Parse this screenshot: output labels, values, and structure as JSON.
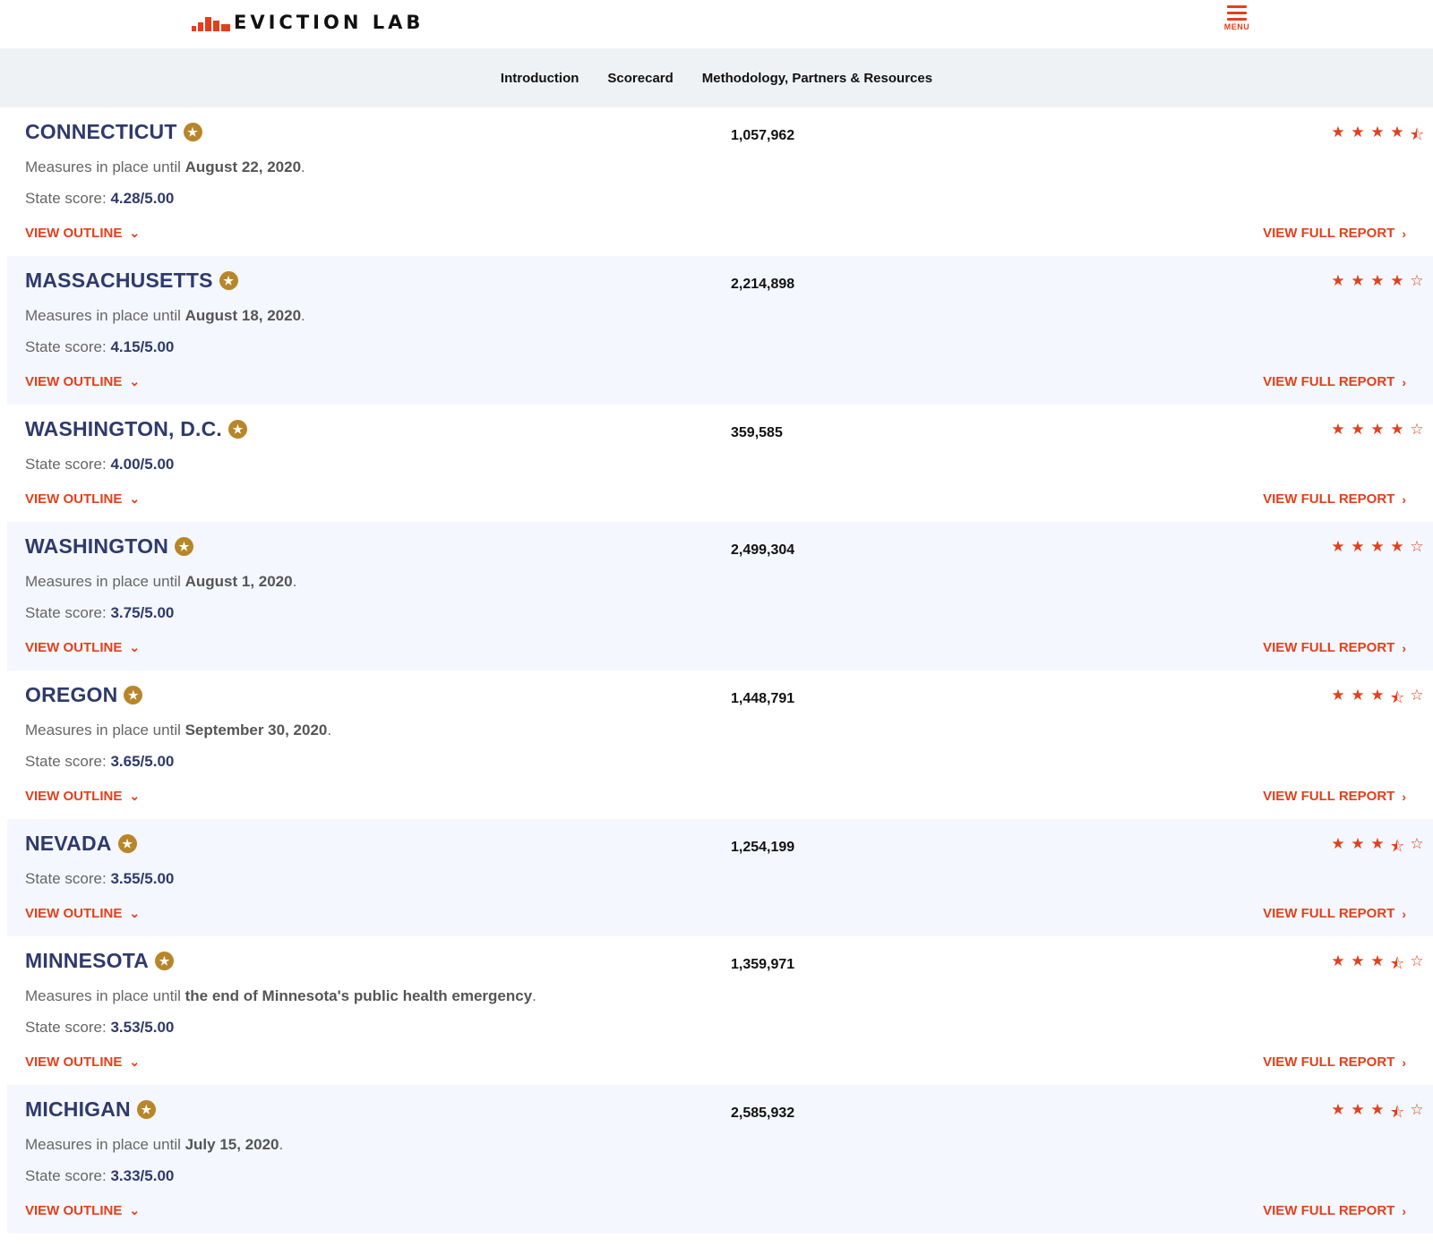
{
  "header": {
    "logo_text": "EVICTION LAB",
    "menu_label": "MENU"
  },
  "subnav": {
    "items": [
      "Introduction",
      "Scorecard",
      "Methodology, Partners & Resources"
    ]
  },
  "states": [
    {
      "name": "CONNECTICUT",
      "renters": "1,057,962",
      "rating": 4.5,
      "measures_prefix": "Measures in place until ",
      "measures_date": "August 22, 2020",
      "score_label": "State score:",
      "score": "4.28/5.00"
    },
    {
      "name": "MASSACHUSETTS",
      "renters": "2,214,898",
      "rating": 4,
      "measures_prefix": "Measures in place until ",
      "measures_date": "August 18, 2020",
      "score_label": "State score:",
      "score": "4.15/5.00"
    },
    {
      "name": "WASHINGTON, D.C.",
      "renters": "359,585",
      "rating": 4,
      "score_label": "State score:",
      "score": "4.00/5.00"
    },
    {
      "name": "WASHINGTON",
      "renters": "2,499,304",
      "rating": 4,
      "measures_prefix": "Measures in place until ",
      "measures_date": "August 1, 2020",
      "score_label": "State score:",
      "score": "3.75/5.00"
    },
    {
      "name": "OREGON",
      "renters": "1,448,791",
      "rating": 3.5,
      "measures_prefix": "Measures in place until ",
      "measures_date": "September 30, 2020",
      "score_label": "State score:",
      "score": "3.65/5.00"
    },
    {
      "name": "NEVADA",
      "renters": "1,254,199",
      "rating": 3.5,
      "score_label": "State score:",
      "score": "3.55/5.00"
    },
    {
      "name": "MINNESOTA",
      "renters": "1,359,971",
      "rating": 3.5,
      "measures_prefix": "Measures in place until ",
      "measures_date": "the end of Minnesota's public health emergency",
      "score_label": "State score:",
      "score": "3.53/5.00"
    },
    {
      "name": "MICHIGAN",
      "renters": "2,585,932",
      "rating": 3.5,
      "measures_prefix": "Measures in place until ",
      "measures_date": "July 15, 2020",
      "score_label": "State score:",
      "score": "3.33/5.00"
    }
  ],
  "labels": {
    "view_outline": "VIEW OUTLINE",
    "view_full_report": "VIEW FULL REPORT"
  },
  "colors": {
    "accent": "#e2401c",
    "title": "#2f3a6b",
    "badge": "#b8862a",
    "subnav_bg": "#eff2f5",
    "alt_row_bg": "#f4f7fd"
  }
}
